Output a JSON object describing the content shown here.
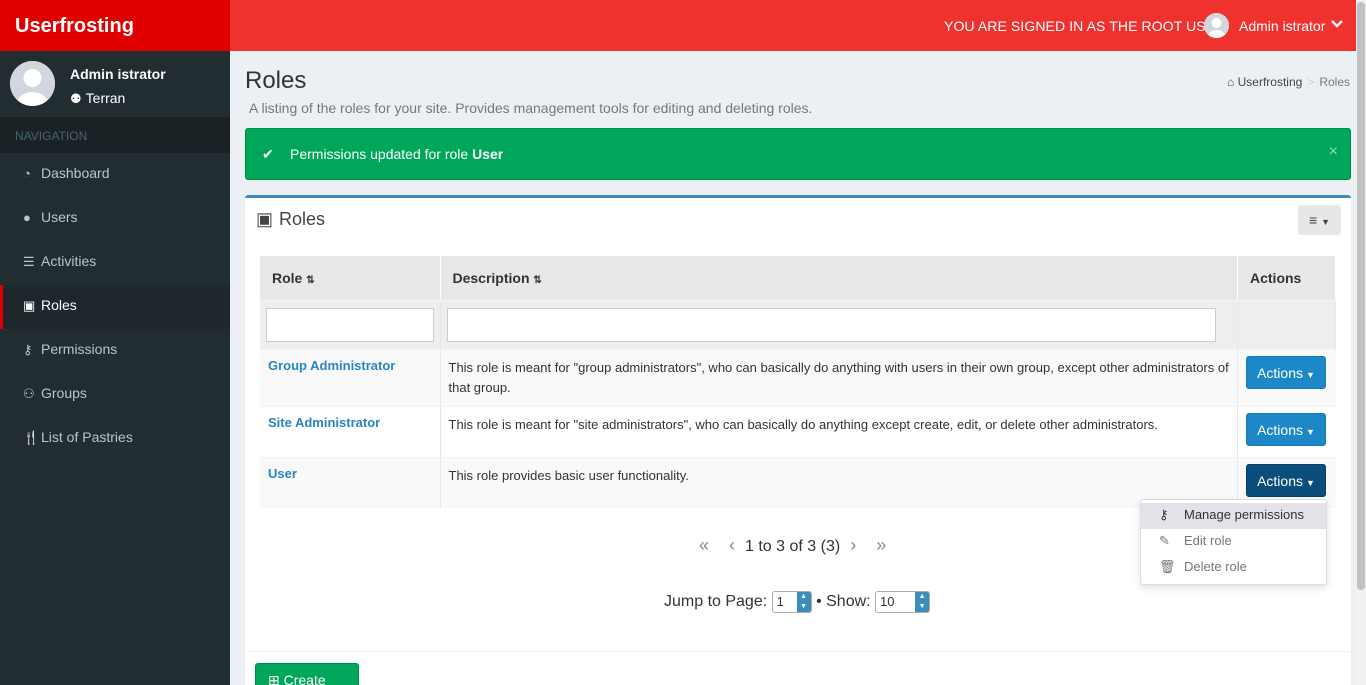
{
  "app": {
    "logo": "Userfrosting"
  },
  "topbar": {
    "signin_text": "YOU ARE SIGNED IN AS THE ROOT USER",
    "username": "Admin istrator"
  },
  "sidebar": {
    "user_name": "Admin istrator",
    "user_group": "Terran",
    "nav_header": "NAVIGATION",
    "items": [
      {
        "label": "Dashboard",
        "icon": "dashboard-icon"
      },
      {
        "label": "Users",
        "icon": "user-icon"
      },
      {
        "label": "Activities",
        "icon": "tasks-icon"
      },
      {
        "label": "Roles",
        "icon": "id-card-icon",
        "active": true
      },
      {
        "label": "Permissions",
        "icon": "key-icon"
      },
      {
        "label": "Groups",
        "icon": "users-icon"
      },
      {
        "label": "List of Pastries",
        "icon": "cutlery-icon"
      }
    ]
  },
  "page": {
    "title": "Roles",
    "description": "A listing of the roles for your site. Provides management tools for editing and deleting roles.",
    "breadcrumb": [
      "Userfrosting",
      "Roles"
    ]
  },
  "alert": {
    "text_prefix": "Permissions updated for role",
    "text_role": "User"
  },
  "box": {
    "title": "Roles",
    "columns": [
      "Role",
      "Description",
      "Actions"
    ],
    "rows": [
      {
        "name": "Group Administrator",
        "description": "This role is meant for \"group administrators\", who can basically do anything with users in their own group, except other administrators of that group.",
        "action": "Actions"
      },
      {
        "name": "Site Administrator",
        "description": "This role is meant for \"site administrators\", who can basically do anything except create, edit, or delete other administrators.",
        "action": "Actions"
      },
      {
        "name": "User",
        "description": "This role provides basic user functionality.",
        "action": "Actions"
      }
    ],
    "dropdown": [
      "Manage permissions",
      "Edit role",
      "Delete role"
    ],
    "pager_text": "1 to 3 of 3 (3)",
    "jump_label": "Jump to Page:",
    "page_value": "1",
    "show_label": "• Show:",
    "show_value": "10",
    "create_label": "Create role"
  }
}
